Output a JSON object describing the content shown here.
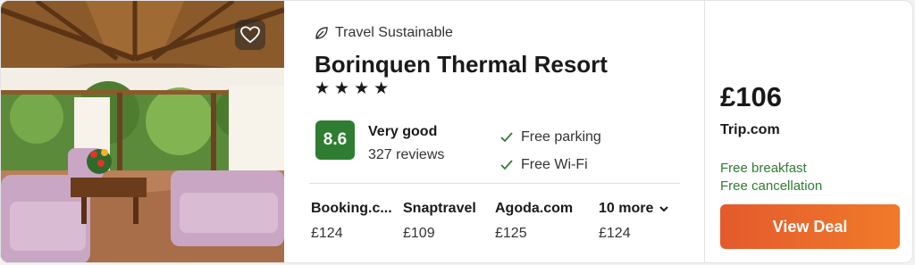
{
  "hotel": {
    "sustainable_label": "Travel Sustainable",
    "name": "Borinquen Thermal Resort",
    "stars": 4,
    "star_glyph": "★",
    "rating_score": "8.6",
    "rating_label": "Very good",
    "reviews": "327 reviews",
    "amenities": [
      "Free parking",
      "Free Wi-Fi"
    ]
  },
  "providers": [
    {
      "name": "Booking.c...",
      "price": "£124"
    },
    {
      "name": "Snaptravel",
      "price": "£109"
    },
    {
      "name": "Agoda.com",
      "price": "£125"
    },
    {
      "name": "10 more",
      "price": "£124"
    }
  ],
  "deal": {
    "price": "£106",
    "site": "Trip.com",
    "perks": [
      "Free breakfast",
      "Free cancellation"
    ],
    "button_label": "View Deal"
  },
  "colors": {
    "rating_green": "#2e7d32",
    "perk_green": "#2e7d32",
    "button_orange": "#e8622b"
  },
  "icons": {
    "favorite": "heart-icon",
    "sustainable": "leaf-icon",
    "amenity": "check-icon",
    "more": "chevron-down-icon"
  }
}
